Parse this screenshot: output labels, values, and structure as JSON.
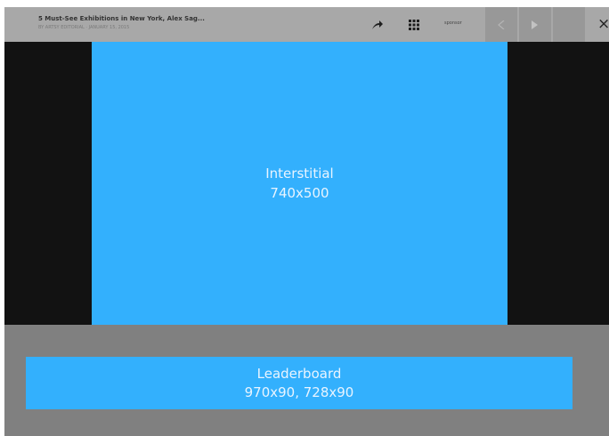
{
  "toolbar": {
    "title": "5 Must-See Exhibitions in New York, Alex Sag...",
    "subtitle": "BY ARTSY EDITORIAL · JANUARY 15, 2015",
    "icons": [
      "share-icon",
      "grid-icon",
      "prev-icon",
      "next-icon",
      "close-icon"
    ],
    "sponsor_label": "sponsor",
    "close_label": "×"
  },
  "interstitial": {
    "line1": "Interstitial",
    "line2": "740x500"
  },
  "leaderboard": {
    "line1": "Leaderboard",
    "line2": "970x90, 728x90"
  },
  "colors": {
    "ad_blue": "#33b0fd",
    "backdrop": "#808080",
    "toolbar": "#a8a8a8",
    "band": "#121212"
  }
}
